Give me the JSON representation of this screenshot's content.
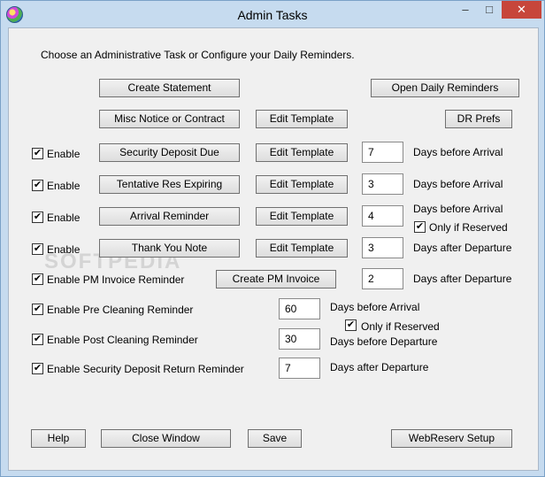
{
  "window": {
    "title": "Admin Tasks",
    "controls": {
      "minimize": "–",
      "maximize": "□",
      "close": "✕"
    },
    "icon": "app-icon"
  },
  "intro_text": "Choose an Administrative Task or Configure your Daily Reminders.",
  "top_buttons": {
    "create_statement": "Create Statement",
    "open_daily_reminders": "Open Daily Reminders",
    "misc_notice": "Misc Notice or Contract",
    "edit_template": "Edit Template",
    "dr_prefs": "DR Prefs"
  },
  "reminders": [
    {
      "enable_label": "Enable",
      "checked": true,
      "task_label": "Security Deposit Due",
      "edit_label": "Edit Template",
      "days": "7",
      "days_label": "Days before Arrival"
    },
    {
      "enable_label": "Enable",
      "checked": true,
      "task_label": "Tentative Res Expiring",
      "edit_label": "Edit Template",
      "days": "3",
      "days_label": "Days before Arrival"
    },
    {
      "enable_label": "Enable",
      "checked": true,
      "task_label": "Arrival Reminder",
      "edit_label": "Edit Template",
      "days": "4",
      "days_label": "Days before Arrival",
      "extra_checkbox": {
        "label": "Only if Reserved",
        "checked": true
      }
    },
    {
      "enable_label": "Enable",
      "checked": true,
      "task_label": "Thank You Note",
      "edit_label": "Edit Template",
      "days": "3",
      "days_label": "Days after Departure"
    }
  ],
  "pm_invoice": {
    "label": "Enable PM Invoice Reminder",
    "checked": true,
    "button_label": "Create PM Invoice",
    "days": "2",
    "days_label": "Days after Departure"
  },
  "cleaning": [
    {
      "label": "Enable Pre Cleaning Reminder",
      "checked": true,
      "days": "60",
      "days_label": "Days before Arrival",
      "extra_checkbox": {
        "label": "Only if Reserved",
        "checked": true
      }
    },
    {
      "label": "Enable Post Cleaning Reminder",
      "checked": true,
      "days": "30",
      "days_label": "Days before Departure"
    },
    {
      "label": "Enable Security Deposit Return Reminder",
      "checked": true,
      "days": "7",
      "days_label": "Days after Departure"
    }
  ],
  "bottom_buttons": {
    "help": "Help",
    "close_window": "Close Window",
    "save": "Save",
    "webreserv_setup": "WebReserv Setup"
  },
  "checkmark": "✔",
  "watermark": "SOFTPEDIA"
}
